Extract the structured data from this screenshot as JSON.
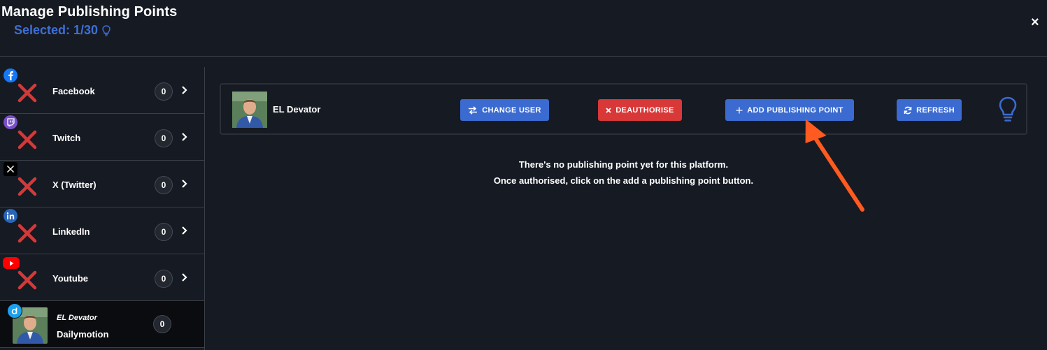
{
  "header": {
    "title": "Manage Publishing Points",
    "selected_text": "Selected: 1/30",
    "close_label": "×"
  },
  "sidebar": {
    "items": [
      {
        "label": "Facebook",
        "count": "0",
        "badge_color": "#1877f2",
        "icon": "facebook-icon"
      },
      {
        "label": "Twitch",
        "count": "0",
        "badge_color": "#7a4fc9",
        "icon": "twitch-icon"
      },
      {
        "label": "X (Twitter)",
        "count": "0",
        "badge_color": "#000000",
        "icon": "x-twitter-icon"
      },
      {
        "label": "LinkedIn",
        "count": "0",
        "badge_color": "#2a66b8",
        "icon": "linkedin-icon"
      },
      {
        "label": "Youtube",
        "count": "0",
        "badge_color": "#ff0000",
        "icon": "youtube-icon"
      }
    ],
    "active": {
      "user": "EL Devator",
      "label": "Dailymotion",
      "count": "0",
      "badge_color": "#1aa1f0",
      "icon": "dailymotion-icon"
    }
  },
  "account": {
    "name": "EL Devator",
    "buttons": {
      "change_user": "CHANGE USER",
      "deauthorise": "DEAUTHORISE",
      "add_publishing_point": "ADD PUBLISHING POINT",
      "refresh": "REFRESH"
    }
  },
  "empty_state": {
    "line1": "There's no publishing point yet for this platform.",
    "line2": "Once authorised, click on the add a publishing point button."
  },
  "colors": {
    "accent_blue": "#3b6bd0",
    "danger_red": "#d83838",
    "annotation_arrow": "#ff5a1f",
    "background": "#161a22"
  }
}
